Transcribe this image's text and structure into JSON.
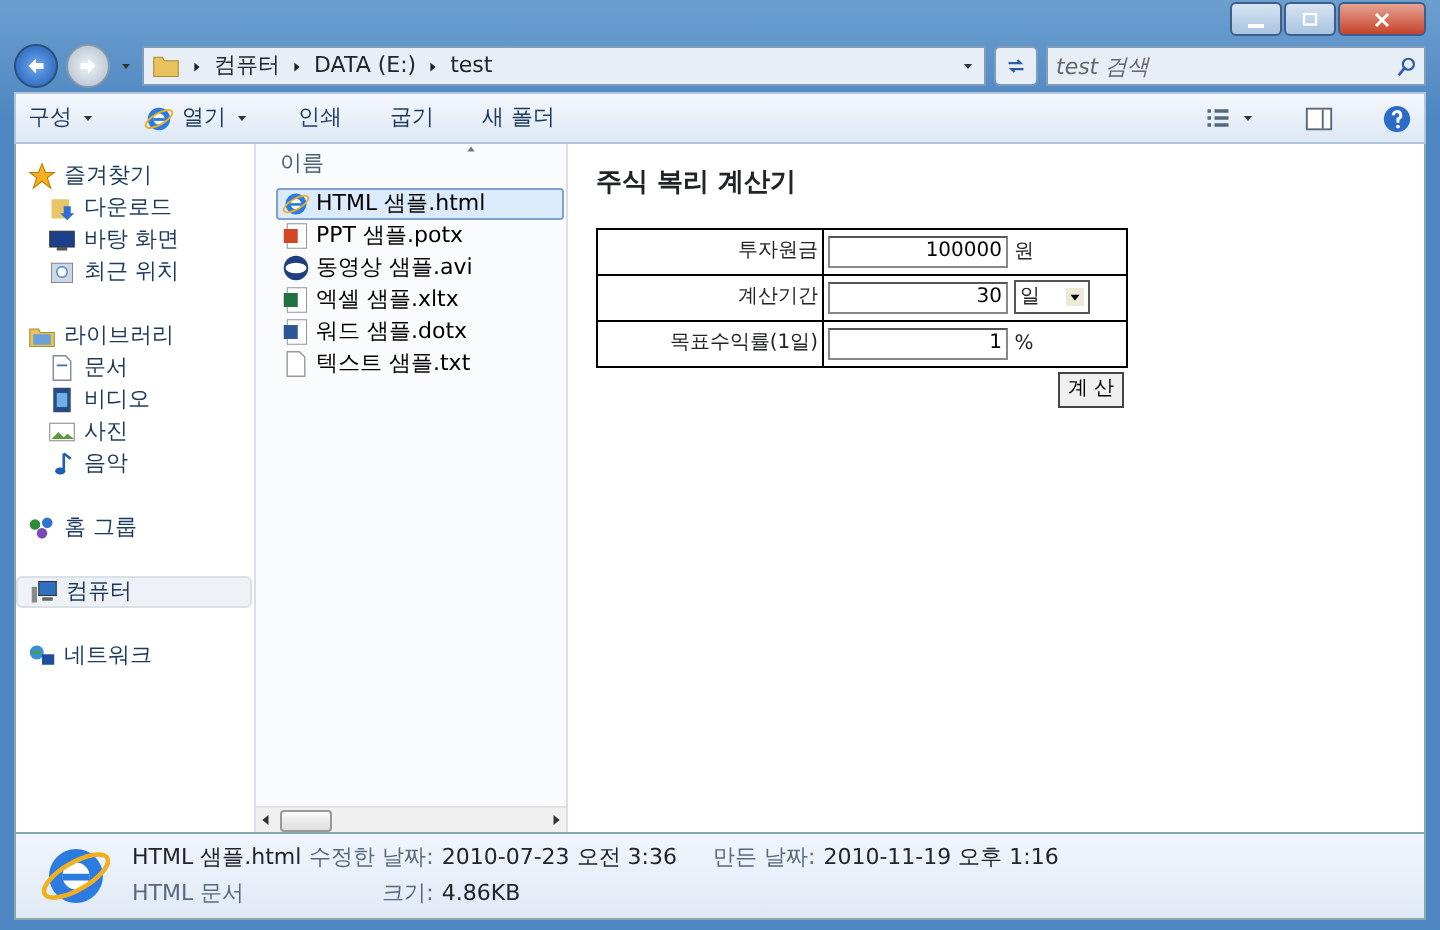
{
  "address": {
    "crumbs": [
      "컴퓨터",
      "DATA (E:)",
      "test"
    ]
  },
  "search": {
    "placeholder": "test 검색"
  },
  "toolbar": {
    "items": [
      {
        "label": "구성",
        "dropdown": true
      },
      {
        "label": "열기",
        "dropdown": true
      },
      {
        "label": "인쇄",
        "dropdown": false
      },
      {
        "label": "굽기",
        "dropdown": false
      },
      {
        "label": "새 폴더",
        "dropdown": false
      }
    ]
  },
  "nav": {
    "groups": [
      {
        "label": "즐겨찾기",
        "kind": "star",
        "selected": false,
        "children": [
          {
            "label": "다운로드",
            "kind": "download",
            "selected": false
          },
          {
            "label": "바탕 화면",
            "kind": "desktop",
            "selected": false
          },
          {
            "label": "최근 위치",
            "kind": "recent",
            "selected": false
          }
        ]
      },
      {
        "label": "라이브러리",
        "kind": "library",
        "selected": false,
        "children": [
          {
            "label": "문서",
            "kind": "doc",
            "selected": false
          },
          {
            "label": "비디오",
            "kind": "video",
            "selected": false
          },
          {
            "label": "사진",
            "kind": "photo",
            "selected": false
          },
          {
            "label": "음악",
            "kind": "music",
            "selected": false
          }
        ]
      },
      {
        "label": "홈 그룹",
        "kind": "homegroup",
        "selected": false
      },
      {
        "label": "컴퓨터",
        "kind": "computer",
        "selected": true
      },
      {
        "label": "네트워크",
        "kind": "network",
        "selected": false
      }
    ]
  },
  "file_list": {
    "column": "이름",
    "files": [
      {
        "name": "HTML 샘플.html",
        "kind": "ie",
        "selected": true
      },
      {
        "name": "PPT 샘플.potx",
        "kind": "ppt",
        "selected": false
      },
      {
        "name": "동영상 샘플.avi",
        "kind": "avi",
        "selected": false
      },
      {
        "name": "엑셀 샘플.xltx",
        "kind": "xls",
        "selected": false
      },
      {
        "name": "워드 샘플.dotx",
        "kind": "word",
        "selected": false
      },
      {
        "name": "텍스트 샘플.txt",
        "kind": "txt",
        "selected": false
      }
    ]
  },
  "preview": {
    "title": "주식 복리 계산기",
    "rows": [
      {
        "label": "투자원금",
        "value": "100000",
        "unit": "원",
        "kind": "text"
      },
      {
        "label": "계산기간",
        "value": "30",
        "unit": "일",
        "kind": "select"
      },
      {
        "label": "목표수익률(1일)",
        "value": "1",
        "unit": "%",
        "kind": "text"
      }
    ],
    "button": "계 산"
  },
  "details": {
    "name": "HTML 샘플.html",
    "type": "HTML 문서",
    "modified_label": "수정한 날짜:",
    "modified": "2010-07-23 오전 3:36",
    "created_label": "만든 날짜:",
    "created": "2010-11-19 오후 1:16",
    "size_label": "크기:",
    "size": "4.86KB"
  }
}
